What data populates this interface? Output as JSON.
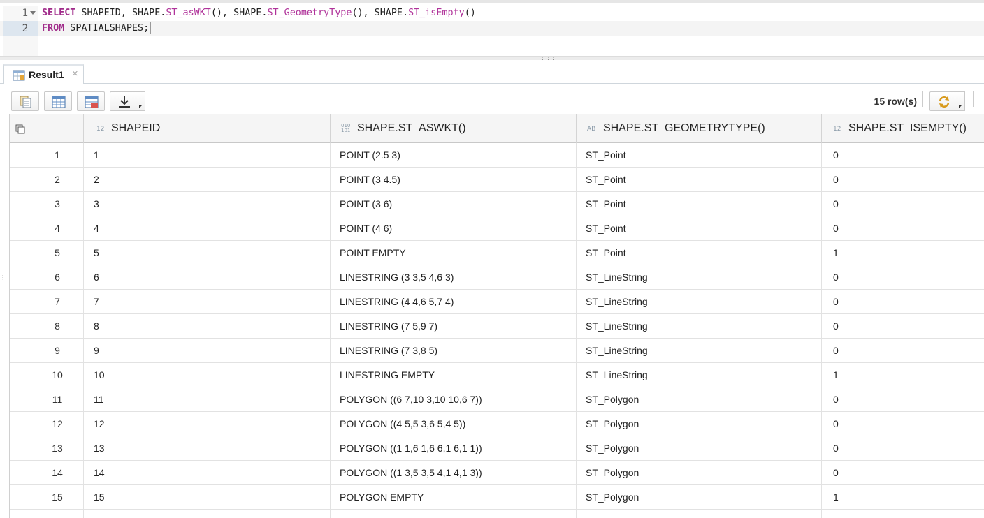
{
  "editor": {
    "lines": [
      {
        "num": "1",
        "parts": [
          {
            "t": "SELECT",
            "k": "kw"
          },
          {
            "t": " SHAPEID, SHAPE.",
            "k": ""
          },
          {
            "t": "ST_asWKT",
            "k": "fn"
          },
          {
            "t": "(), SHAPE.",
            "k": ""
          },
          {
            "t": "ST_GeometryType",
            "k": "fn"
          },
          {
            "t": "(), SHAPE.",
            "k": ""
          },
          {
            "t": "ST_isEmpty",
            "k": "fn"
          },
          {
            "t": "()",
            "k": ""
          }
        ]
      },
      {
        "num": "2",
        "parts": [
          {
            "t": "FROM",
            "k": "kw"
          },
          {
            "t": " SPATIALSHAPES;",
            "k": ""
          }
        ]
      }
    ]
  },
  "result_tab": {
    "label": "Result1",
    "close": "×"
  },
  "toolbar": {
    "row_count": "15 row(s)"
  },
  "grid": {
    "columns": [
      {
        "type": "12",
        "name": "SHAPEID"
      },
      {
        "type": "010\n101",
        "name": "SHAPE.ST_ASWKT()"
      },
      {
        "type": "AB",
        "name": "SHAPE.ST_GEOMETRYTYPE()"
      },
      {
        "type": "12",
        "name": "SHAPE.ST_ISEMPTY()"
      }
    ],
    "rows": [
      [
        "1",
        "1",
        "POINT (2.5 3)",
        "ST_Point",
        "0"
      ],
      [
        "2",
        "2",
        "POINT (3 4.5)",
        "ST_Point",
        "0"
      ],
      [
        "3",
        "3",
        "POINT (3 6)",
        "ST_Point",
        "0"
      ],
      [
        "4",
        "4",
        "POINT (4 6)",
        "ST_Point",
        "0"
      ],
      [
        "5",
        "5",
        "POINT EMPTY",
        "ST_Point",
        "1"
      ],
      [
        "6",
        "6",
        "LINESTRING (3 3,5 4,6 3)",
        "ST_LineString",
        "0"
      ],
      [
        "7",
        "7",
        "LINESTRING (4 4,6 5,7 4)",
        "ST_LineString",
        "0"
      ],
      [
        "8",
        "8",
        "LINESTRING (7 5,9 7)",
        "ST_LineString",
        "0"
      ],
      [
        "9",
        "9",
        "LINESTRING (7 3,8 5)",
        "ST_LineString",
        "0"
      ],
      [
        "10",
        "10",
        "LINESTRING EMPTY",
        "ST_LineString",
        "1"
      ],
      [
        "11",
        "11",
        "POLYGON ((6 7,10 3,10 10,6 7))",
        "ST_Polygon",
        "0"
      ],
      [
        "12",
        "12",
        "POLYGON ((4 5,5 3,6 5,4 5))",
        "ST_Polygon",
        "0"
      ],
      [
        "13",
        "13",
        "POLYGON ((1 1,6 1,6 6,1 6,1 1))",
        "ST_Polygon",
        "0"
      ],
      [
        "14",
        "14",
        "POLYGON ((1 3,5 3,5 4,1 4,1 3))",
        "ST_Polygon",
        "0"
      ],
      [
        "15",
        "15",
        "POLYGON EMPTY",
        "ST_Polygon",
        "1"
      ]
    ]
  },
  "icons": {
    "copy": "copy-icon",
    "grid_view": "grid-view-icon",
    "export_table": "table-export-icon",
    "download": "download-icon",
    "refresh": "refresh-icon"
  },
  "colors": {
    "keyword": "#a02b8a",
    "function": "#b0339a",
    "header_bg": "#f5f5f5",
    "line_highlight": "#dde6ef"
  }
}
